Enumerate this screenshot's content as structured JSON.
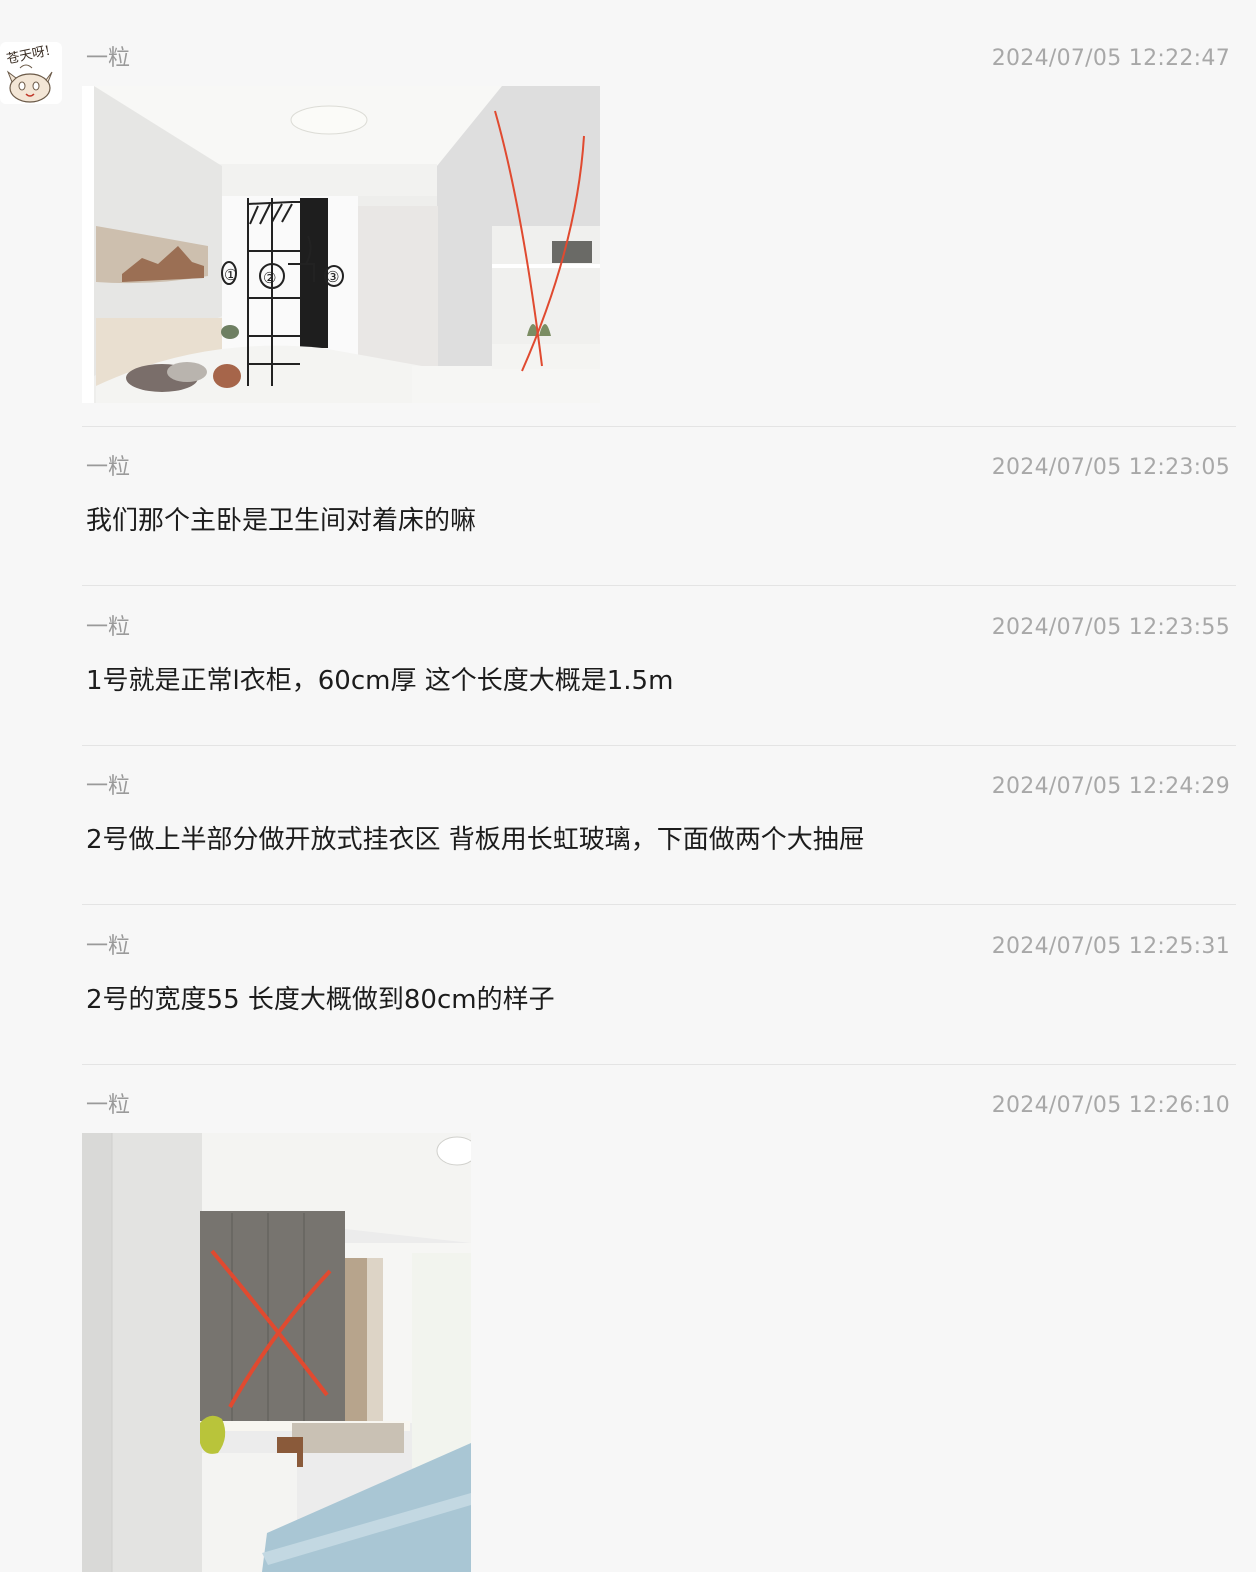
{
  "messages": [
    {
      "sender": "一粒",
      "time": "2024/07/05 12:22:47",
      "image": "bedroom-render-with-sketch-markings",
      "image_labels": [
        "①",
        "②",
        "③"
      ]
    },
    {
      "sender": "一粒",
      "time": "2024/07/05 12:23:05",
      "text": "我们那个主卧是卫生间对着床的嘛"
    },
    {
      "sender": "一粒",
      "time": "2024/07/05 12:23:55",
      "text": "1号就是正常l衣柜，60cm厚 这个长度大概是1.5m"
    },
    {
      "sender": "一粒",
      "time": "2024/07/05 12:24:29",
      "text": "2号做上半部分做开放式挂衣区 背板用长虹玻璃，下面做两个大抽屉"
    },
    {
      "sender": "一粒",
      "time": "2024/07/05 12:25:31",
      "text": "2号的宽度55 长度大概做到80cm的样子"
    },
    {
      "sender": "一粒",
      "time": "2024/07/05 12:26:10",
      "image": "bedroom-photo-with-red-x"
    }
  ],
  "avatar": {
    "text": "苍天呀!"
  },
  "colors": {
    "annotation_red": "#e04a30",
    "background": "#f7f7f7"
  }
}
